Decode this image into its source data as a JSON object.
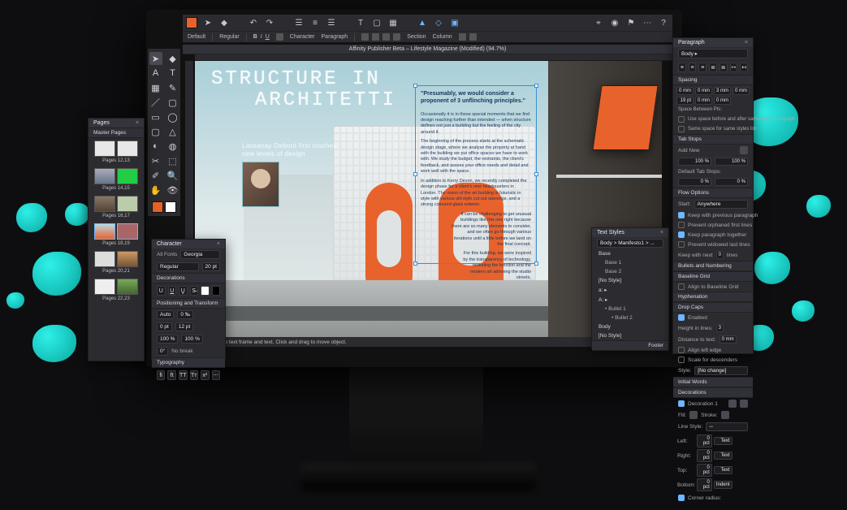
{
  "app": {
    "document_title": "Affinity Publisher Beta – Lifestyle Magazine (Modified) (94.7%)"
  },
  "topbar": {
    "persona_labels": [
      "Designer",
      "Vector",
      "Pixel"
    ]
  },
  "ribbon": {
    "default_label": "Default",
    "regular_label": "Regular",
    "character_label": "Character",
    "paragraph_label": "Paragraph",
    "section_label": "Section",
    "column_label": "Column"
  },
  "status": {
    "snap_hint": "Snap to text frame and text.  Click and drag to move object."
  },
  "headline": {
    "line1": "STRUCTURE IN",
    "line2": "ARCHITETTI"
  },
  "subhead": {
    "line1": "Lassanay Debord first touches",
    "line2": "new levels of design"
  },
  "pull_quote": "\"Presumably, we would consider a proponent of 3 unflinching principles.\"",
  "body": {
    "p1": "Occasionally it is in these special moments that we find design reaching further than intended — when structure defines not just a building but the feeling of the city around it.",
    "p2": "The beginning of the process starts at the schematic design stage, where we analyse the property at hand with the building we put office spaces we have to work with. We study the budget, the restraints, the client's feedback, and assess your office needs and detail and work well with the space.",
    "p3": "In addition to Kerry Devon, we recently completed the design phase for a client's new headquarters in London. The vision of the art building is futuristic in style with various slit-style cut-out openings, and a strong coloured glass exterior.",
    "p4": "It can be challenging to get unusual buildings like this one right because there are so many elements to consider, and we often go through various iterations until a little before we land on the final concept.",
    "p5": "For this building, we were inspired by the transparency of technology, revealing the function and the modern art adorning the studio streets."
  },
  "pages_panel": {
    "title": "Pages",
    "tab_master": "Master Pages",
    "labels": [
      "Pages 12,13",
      "Pages 14,15",
      "Pages 16,17",
      "Pages 18,19",
      "Pages 20,21",
      "Pages 22,23"
    ]
  },
  "character_panel": {
    "title": "Character",
    "font_collection_label": "All Fonts",
    "font_family": "Georgia",
    "font_style": "Regular",
    "size": "20 pt",
    "decorations": "Decorations",
    "pos_transform": "Positioning and Transform",
    "typography": "Typography",
    "none_label": "No break",
    "kern": "Auto",
    "track": "0 ‰",
    "baseline": "0 pt",
    "leading": "12 pt",
    "scale_h": "100 %",
    "scale_v": "100 %",
    "shear": "0°"
  },
  "text_styles_panel": {
    "title": "Text Styles",
    "current_style": "Body > Manifesto1 > ...",
    "items": [
      "Base",
      "Base 1",
      "Base 2",
      "[No Style]",
      "a: ▸",
      "A: ▸",
      "• Bullet 1",
      "• Bullet 2",
      "Body",
      "[No Style]"
    ],
    "footer": "Footer"
  },
  "paragraph_panel": {
    "title": "Paragraph",
    "style_current": "Body ▸",
    "spacing_section": "Spacing",
    "left_indent": "0 mm",
    "right_indent": "0 mm",
    "first_indent": "3 mm",
    "last_indent": "0 mm",
    "leading_mode": "19 pt",
    "space_before": "0 mm",
    "space_after": "0 mm",
    "same_style_label": "Use space before and after same-style paragraph",
    "same_style2": "Same space for same styles list",
    "space_between_label": "Space Between Pts:",
    "tabs_section": "Tab Stops",
    "tabs_add": "Add New",
    "default_tab": "100 %",
    "tab_val2": "100 %",
    "default_tab_label": "Default Tab Stops:",
    "tab_width_a": "0 %",
    "tab_width_b": "0 %",
    "flow_section": "Flow Options",
    "start_label": "Start:",
    "start_value": "Anywhere",
    "opt_keep_prev": "Keep with previous paragraph",
    "opt_widow": "Prevent orphaned first lines",
    "opt_keep_together": "Keep paragraph together",
    "opt_orphan": "Prevent widowed last lines",
    "keep_with_next": "Keep with next",
    "keep_lines": "lines",
    "keep_lines_n": "0",
    "bullets_section": "Bullets and Numbering",
    "baseline_section": "Baseline Grid",
    "align_baseline": "Align to Baseline Grid",
    "hyphen_section": "Hyphenation",
    "dropcaps_section": "Drop Caps",
    "dropcaps_enabled": "Enabled",
    "height_lines_label": "Height in lines:",
    "height_lines": "3",
    "distance_label": "Distance to text:",
    "distance": "0 mm",
    "align_left_label": "Align left edge",
    "scale_desc_label": "Scale for descenders",
    "style_label": "Style:",
    "style_value": "[No change]",
    "initial_section": "Initial Words",
    "decoration_section": "Decorations",
    "deco_item": "Decoration 1",
    "fill_label": "Fill:",
    "stroke_label": "Stroke:",
    "line_style_label": "Line Style:",
    "left_label": "Left:",
    "l_unit": "0 pct",
    "l_mode": "Text",
    "right_label": "Right:",
    "r_unit": "0 pct",
    "r_mode": "Text",
    "top_label": "Top:",
    "t_unit": "0 pct",
    "t_mode": "Text",
    "bottom_label": "Bottom:",
    "b_unit": "0 pct",
    "b_mode": "Indent",
    "corner_label": "Corner radius:"
  }
}
